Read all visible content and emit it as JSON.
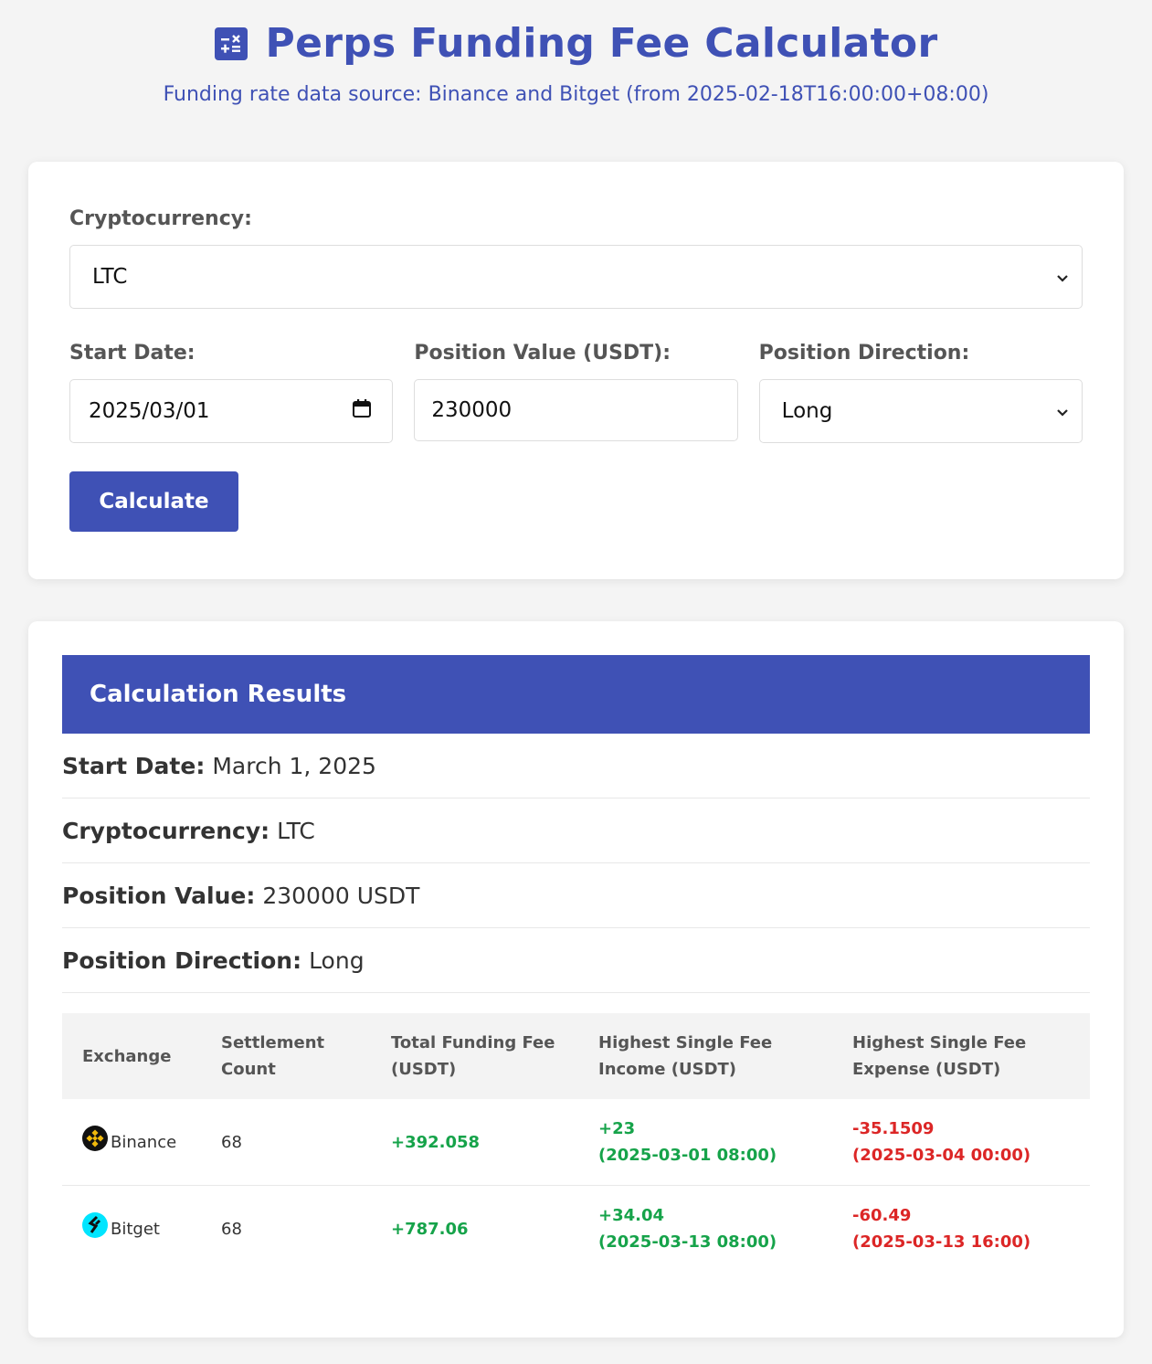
{
  "header": {
    "title": "Perps Funding Fee Calculator",
    "subtitle": "Funding rate data source: Binance and Bitget (from 2025-02-18T16:00:00+08:00)",
    "icon": "calculator-icon"
  },
  "form": {
    "crypto_label": "Cryptocurrency:",
    "crypto_value": "LTC",
    "start_date_label": "Start Date:",
    "start_date_value": "2025/03/01",
    "position_value_label": "Position Value (USDT):",
    "position_value_value": "230000",
    "direction_label": "Position Direction:",
    "direction_value": "Long",
    "calculate_label": "Calculate"
  },
  "results": {
    "title": "Calculation Results",
    "summary": [
      {
        "label": "Start Date:",
        "value": "March 1, 2025"
      },
      {
        "label": "Cryptocurrency:",
        "value": "LTC"
      },
      {
        "label": "Position Value:",
        "value": "230000 USDT"
      },
      {
        "label": "Position Direction:",
        "value": "Long"
      }
    ],
    "table": {
      "headers": [
        "Exchange",
        "Settlement Count",
        "Total Funding Fee (USDT)",
        "Highest Single Fee Income (USDT)",
        "Highest Single Fee Expense (USDT)"
      ],
      "rows": [
        {
          "exchange": "Binance",
          "count": "68",
          "total": "+392.058",
          "income": "+23",
          "income_time": "(2025-03-01 08:00)",
          "expense": "-35.1509",
          "expense_time": "(2025-03-04 00:00)"
        },
        {
          "exchange": "Bitget",
          "count": "68",
          "total": "+787.06",
          "income": "+34.04",
          "income_time": "(2025-03-13 08:00)",
          "expense": "-60.49",
          "expense_time": "(2025-03-13 16:00)"
        }
      ]
    }
  },
  "colors": {
    "primary": "#3f51b5",
    "positive": "#16a34a",
    "negative": "#dc2626",
    "binance": "#f0b90b",
    "bitget": "#00e5ff"
  }
}
